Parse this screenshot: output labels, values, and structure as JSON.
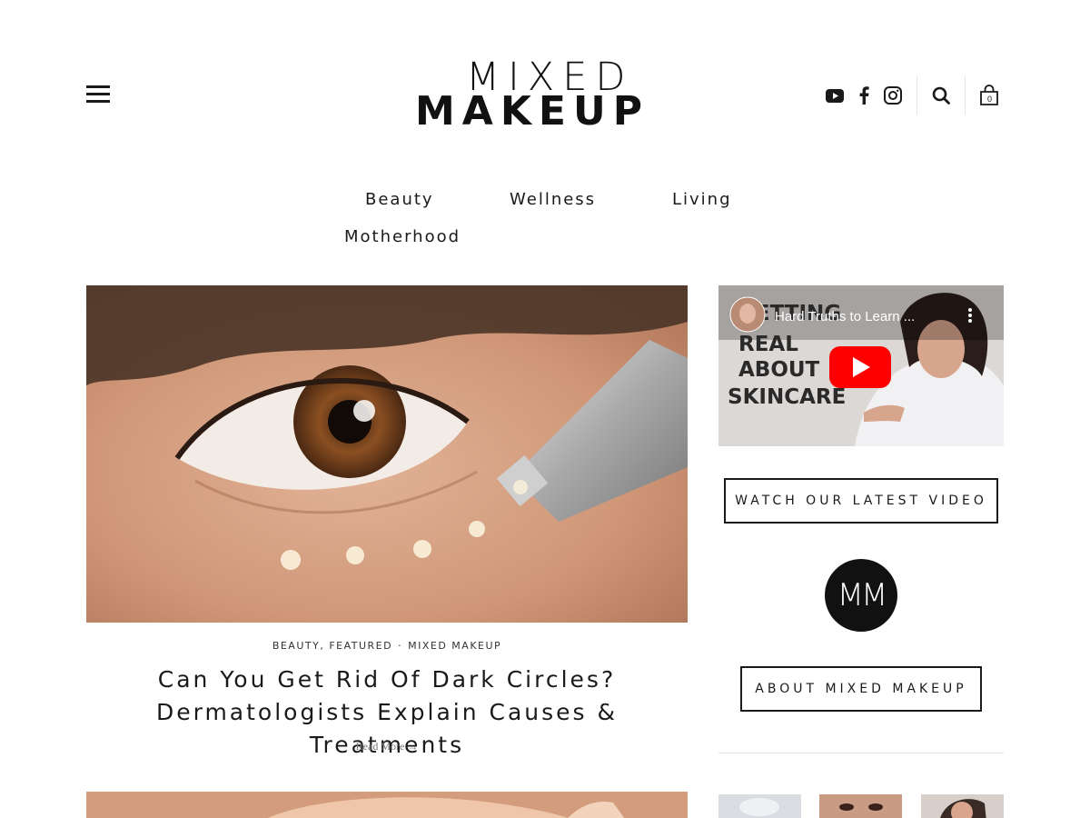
{
  "header": {
    "logo_top": "MIXED",
    "logo_bottom": "MAKEUP",
    "icons": [
      "hamburger-menu-icon",
      "youtube-icon",
      "facebook-icon",
      "instagram-icon",
      "search-icon",
      "shopping-bag-icon"
    ],
    "cart_count": "0"
  },
  "nav": {
    "items": [
      "Beauty",
      "Wellness",
      "Living",
      "Motherhood"
    ]
  },
  "featured_post": {
    "categories": "BEAUTY, FEATURED",
    "separator": "·",
    "author": "MIXED MAKEUP",
    "title": "Can You Get Rid Of Dark Circles? Dermatologists Explain Causes & Treatments",
    "read_more": "Read More →"
  },
  "sidebar": {
    "video": {
      "title": "Hard Truths to Learn ...",
      "thumbnail_text": [
        "GETTING",
        "REAL",
        "ABOUT",
        "SKINCARE"
      ]
    },
    "watch_button": "WATCH OUR LATEST VIDEO",
    "badge_text": "MM",
    "about_button": "ABOUT MIXED MAKEUP"
  },
  "colors": {
    "text": "#1a1a1a",
    "youtube_red": "#ff0000",
    "badge_bg": "#111111"
  }
}
